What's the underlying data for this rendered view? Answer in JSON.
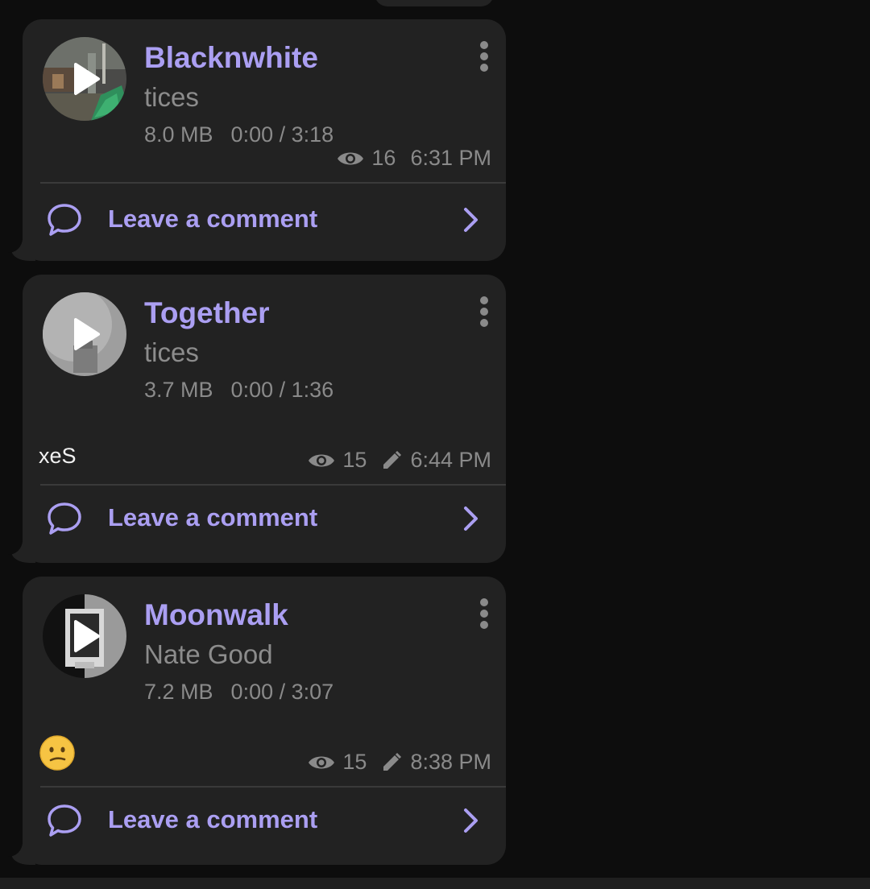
{
  "colors": {
    "background": "#0d0d0d",
    "bubble": "#222222",
    "accent": "#ab9ff2",
    "muted": "#8a8a8a",
    "divider": "#3a3a3a"
  },
  "posts": [
    {
      "title": "Blacknwhite",
      "artist": "tices",
      "size": "8.0 MB",
      "duration": "0:00 / 3:18",
      "caption": "",
      "emoji": "",
      "views": "16",
      "edited": false,
      "time": "6:31 PM",
      "comment_label": "Leave a comment",
      "icons": {
        "play": "play-icon",
        "menu": "more-vertical-icon",
        "views": "eye-icon",
        "comment": "comment-bubble-icon",
        "open": "chevron-right-icon"
      }
    },
    {
      "title": "Together",
      "artist": "tices",
      "size": "3.7 MB",
      "duration": "0:00 / 1:36",
      "caption": "xeS",
      "emoji": "",
      "views": "15",
      "edited": true,
      "time": "6:44 PM",
      "comment_label": "Leave a comment",
      "icons": {
        "play": "play-icon",
        "menu": "more-vertical-icon",
        "views": "eye-icon",
        "edited": "pencil-icon",
        "comment": "comment-bubble-icon",
        "open": "chevron-right-icon"
      }
    },
    {
      "title": "Moonwalk",
      "artist": "Nate Good",
      "size": "7.2 MB",
      "duration": "0:00 / 3:07",
      "caption": "",
      "emoji": "confused-face-emoji",
      "views": "15",
      "edited": true,
      "time": "8:38 PM",
      "comment_label": "Leave a comment",
      "icons": {
        "play": "play-icon",
        "menu": "more-vertical-icon",
        "views": "eye-icon",
        "edited": "pencil-icon",
        "comment": "comment-bubble-icon",
        "open": "chevron-right-icon"
      }
    }
  ]
}
